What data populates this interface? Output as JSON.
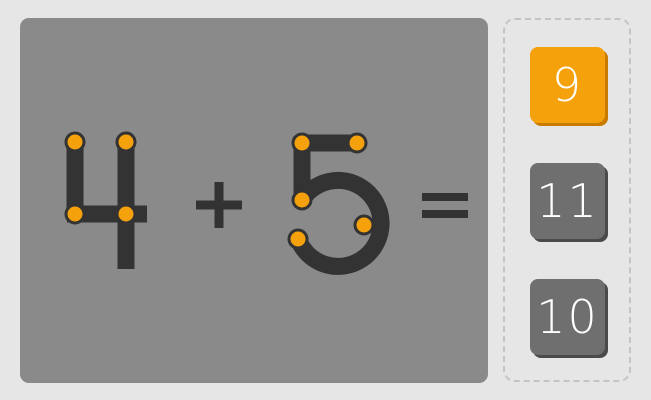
{
  "puzzle": {
    "operand_a": "4",
    "operator": "+",
    "operand_b": "5",
    "equals": "="
  },
  "answers": [
    {
      "label": "9",
      "state": "selected"
    },
    {
      "label": "11",
      "state": "normal"
    },
    {
      "label": "10",
      "state": "normal"
    }
  ],
  "colors": {
    "background": "#e6e6e6",
    "board": "#8a8a8a",
    "stroke": "#333333",
    "node": "#f4a10c",
    "tile_selected": "#f4a10c",
    "tile_normal": "#6f6f6f"
  }
}
